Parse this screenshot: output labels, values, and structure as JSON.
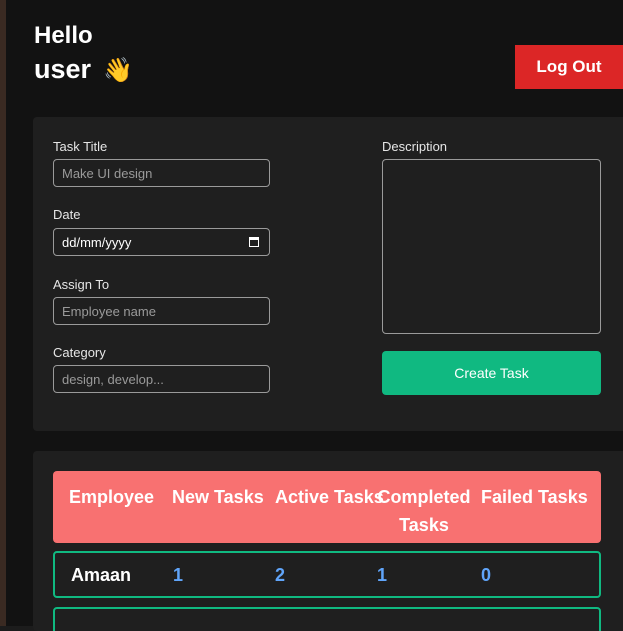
{
  "header": {
    "greeting": "Hello",
    "username": "user",
    "wave_emoji": "👋",
    "logout_label": "Log Out"
  },
  "form": {
    "task_title_label": "Task Title",
    "task_title_placeholder": "Make UI design",
    "date_label": "Date",
    "date_placeholder": "dd/mm/yyyy",
    "assign_label": "Assign To",
    "assign_placeholder": "Employee name",
    "category_label": "Category",
    "category_placeholder": "design, develop...",
    "description_label": "Description",
    "create_button_label": "Create Task"
  },
  "table": {
    "headers": [
      "Employee",
      "New Tasks",
      "Active Tasks",
      "Completed Tasks",
      "Failed Tasks"
    ],
    "rows": [
      {
        "name": "Amaan",
        "new": "1",
        "active": "2",
        "completed": "1",
        "failed": "0"
      }
    ]
  },
  "colors": {
    "logout_bg": "#dc2626",
    "create_bg": "#10b981",
    "table_header_bg": "#f87171",
    "row_border": "#10b981",
    "number_color": "#60a5fa"
  }
}
